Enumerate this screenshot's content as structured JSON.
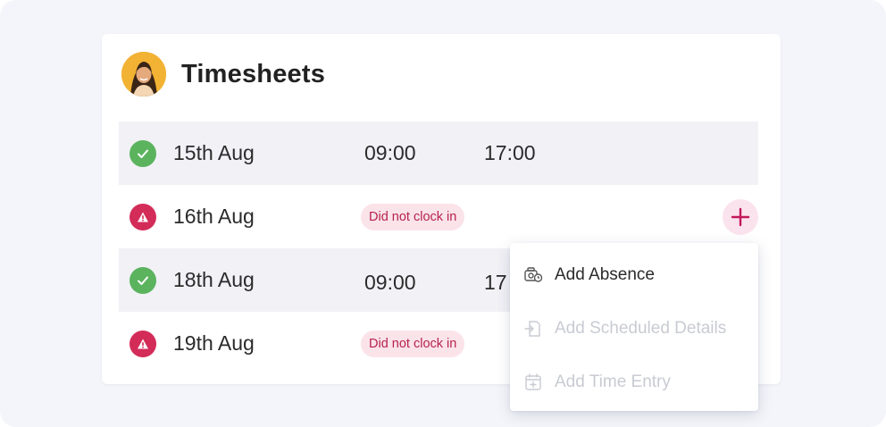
{
  "header": {
    "title": "Timesheets"
  },
  "rows": [
    {
      "date": "15th Aug",
      "status": "ok",
      "time_in": "09:00",
      "time_out": "17:00"
    },
    {
      "date": "16th Aug",
      "status": "warn",
      "badge": "Did not clock in"
    },
    {
      "date": "18th Aug",
      "status": "ok",
      "time_in": "09:00",
      "time_out": "17"
    },
    {
      "date": "19th Aug",
      "status": "warn",
      "badge": "Did not clock in"
    }
  ],
  "menu": {
    "items": [
      {
        "label": "Add Absence",
        "icon": "absence-icon",
        "enabled": true
      },
      {
        "label": "Add Scheduled Details",
        "icon": "scheduled-details-icon",
        "enabled": false
      },
      {
        "label": "Add Time Entry",
        "icon": "calendar-plus-icon",
        "enabled": false
      }
    ]
  },
  "colors": {
    "ok": "#5bb35e",
    "warn": "#d32c59",
    "badge_bg": "#fbe3ea",
    "badge_text": "#b5234d",
    "accent": "#c2185b"
  }
}
